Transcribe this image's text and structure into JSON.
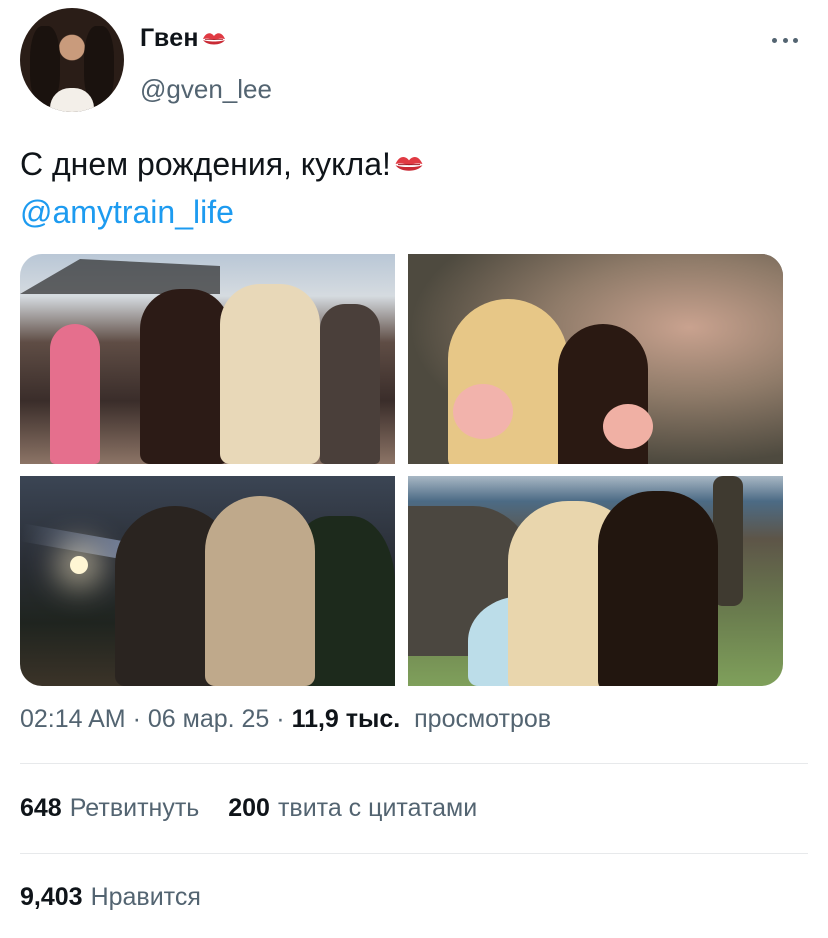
{
  "author": {
    "display_name": "Гвен",
    "handle": "@gven_lee"
  },
  "icons": {
    "name_emoji": "kiss-mark-icon",
    "text_emoji": "kiss-mark-icon",
    "more": "more-horizontal-icon"
  },
  "tweet": {
    "text": "С днем рождения, кукла!",
    "mention": "@amytrain_life"
  },
  "meta": {
    "time": "02:14 AM",
    "sep1": "·",
    "date": "06 мар. 25",
    "sep2": "·",
    "views_count": "11,9 тыс.",
    "views_label": "просмотров"
  },
  "stats": {
    "retweets_count": "648",
    "retweets_label": "Ретвитнуть",
    "quotes_count": "200",
    "quotes_label": "твита с цитатами",
    "likes_count": "9,403",
    "likes_label": "Нравится"
  },
  "colors": {
    "link": "#1d9bf0",
    "secondary_text": "#536471",
    "primary_text": "#0f1419",
    "kiss": "#d9333f"
  }
}
